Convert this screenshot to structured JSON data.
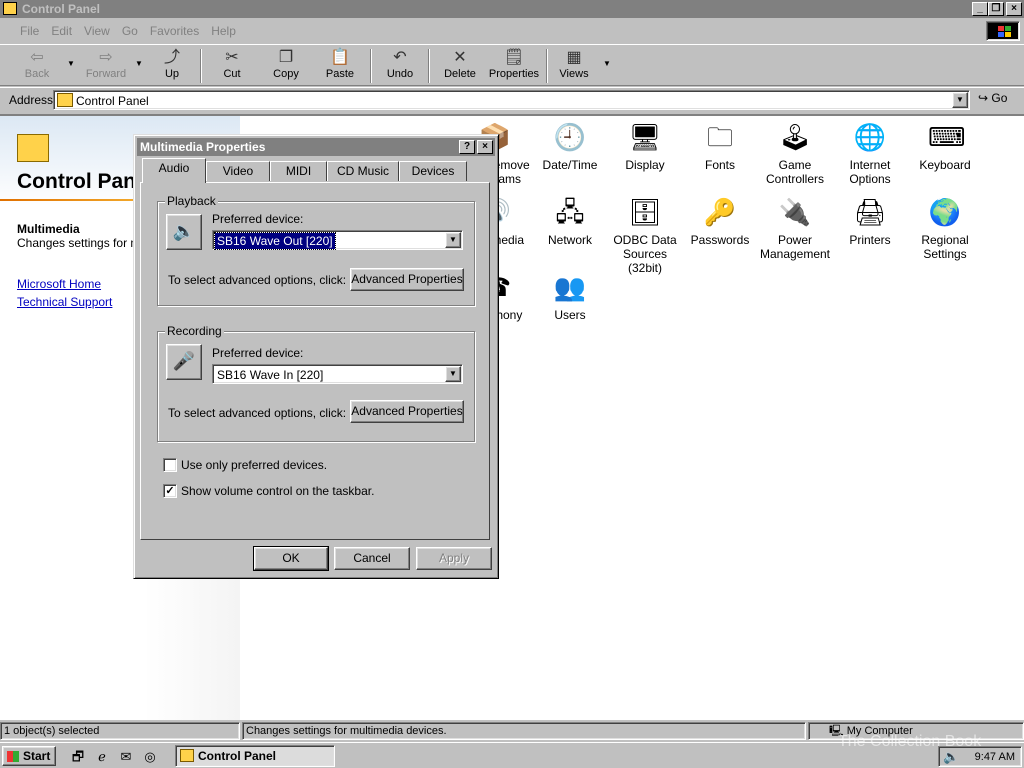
{
  "window": {
    "title": "Control Panel"
  },
  "menu": [
    "File",
    "Edit",
    "View",
    "Go",
    "Favorites",
    "Help"
  ],
  "toolbar": {
    "back": "Back",
    "forward": "Forward",
    "up": "Up",
    "cut": "Cut",
    "copy": "Copy",
    "paste": "Paste",
    "undo": "Undo",
    "delete": "Delete",
    "properties": "Properties",
    "views": "Views"
  },
  "address": {
    "label": "Address",
    "value": "Control Panel",
    "go": "Go"
  },
  "leftpane": {
    "title": "Control Panel",
    "selected_name": "Multimedia",
    "selected_desc": "Changes settings for multimedia devices.",
    "links": [
      "Microsoft Home",
      "Technical Support"
    ]
  },
  "icons": [
    {
      "label": "Add/Remove Programs",
      "glyph": "📦"
    },
    {
      "label": "Date/Time",
      "glyph": "🕘"
    },
    {
      "label": "Display",
      "glyph": "🖥"
    },
    {
      "label": "Fonts",
      "glyph": "🗀"
    },
    {
      "label": "Game Controllers",
      "glyph": "🕹"
    },
    {
      "label": "Internet Options",
      "glyph": "🌐"
    },
    {
      "label": "Keyboard",
      "glyph": "⌨"
    },
    {
      "label": "Multimedia",
      "glyph": "🔊"
    },
    {
      "label": "Network",
      "glyph": "🖧"
    },
    {
      "label": "ODBC Data Sources (32bit)",
      "glyph": "🗄"
    },
    {
      "label": "Passwords",
      "glyph": "🔑"
    },
    {
      "label": "Power Management",
      "glyph": "🔌"
    },
    {
      "label": "Printers",
      "glyph": "🖨"
    },
    {
      "label": "Regional Settings",
      "glyph": "🌍"
    },
    {
      "label": "Telephony",
      "glyph": "☎"
    },
    {
      "label": "Users",
      "glyph": "👥"
    }
  ],
  "dialog": {
    "title": "Multimedia Properties",
    "tabs": [
      "Audio",
      "Video",
      "MIDI",
      "CD Music",
      "Devices"
    ],
    "playback": {
      "label": "Playback",
      "pref_label": "Preferred device:",
      "device": "SB16 Wave Out [220]",
      "hint": "To select advanced options, click:",
      "adv_button": "Advanced Properties"
    },
    "recording": {
      "label": "Recording",
      "pref_label": "Preferred device:",
      "device": "SB16 Wave In [220]",
      "hint": "To select advanced options, click:",
      "adv_button": "Advanced Properties"
    },
    "checkbox_preferred": {
      "label": "Use only preferred devices.",
      "checked": false
    },
    "checkbox_volume": {
      "label": "Show volume control on the taskbar.",
      "checked": true
    },
    "ok": "OK",
    "cancel": "Cancel",
    "apply": "Apply"
  },
  "status": {
    "left": "1 object(s) selected",
    "middle": "Changes settings for multimedia devices.",
    "right": "My Computer"
  },
  "taskbar": {
    "start": "Start",
    "task": "Control Panel",
    "clock": "9:47 AM"
  },
  "watermark": "The Collection Book"
}
